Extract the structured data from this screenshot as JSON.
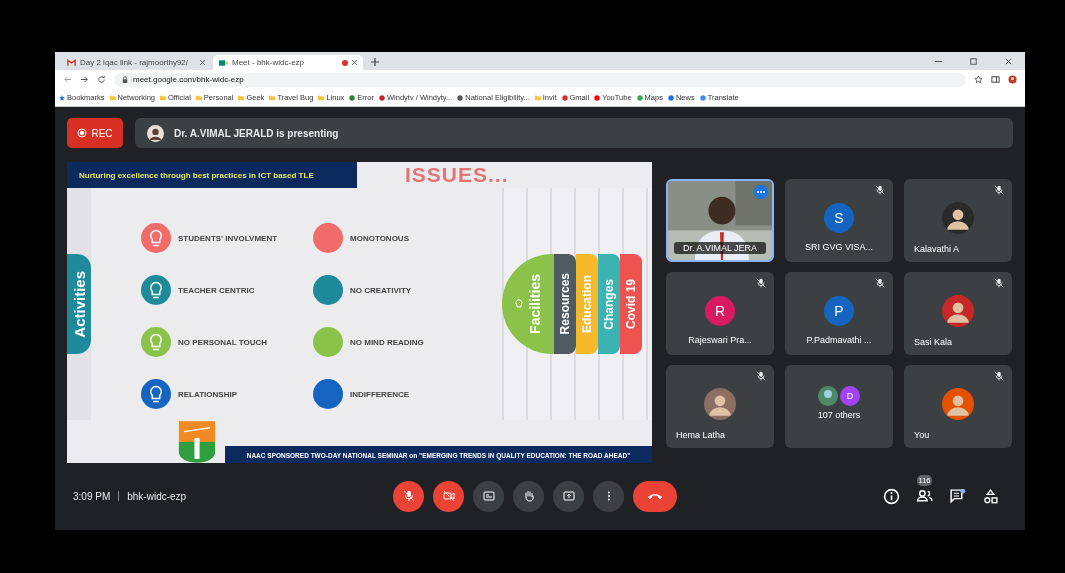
{
  "browser": {
    "tabs": [
      {
        "title": "Day 2 iqac link - rajmoorthy92/",
        "kind": "mail",
        "selected": false,
        "recording": false
      },
      {
        "title": "Meet - bhk-widc-ezp",
        "kind": "meet",
        "selected": true,
        "recording": true
      }
    ],
    "url": "meet.google.com/bhk-widc-ezp",
    "bookmarks": [
      {
        "label": "Bookmarks",
        "kind": "star",
        "color": "#1a73e8"
      },
      {
        "label": "Networking",
        "kind": "folder",
        "color": "#f9c33c"
      },
      {
        "label": "Official",
        "kind": "folder",
        "color": "#f9c33c"
      },
      {
        "label": "Personal",
        "kind": "folder",
        "color": "#f9c33c"
      },
      {
        "label": "Geek",
        "kind": "folder",
        "color": "#f9c33c"
      },
      {
        "label": "Travel Bug",
        "kind": "folder",
        "color": "#f9c33c"
      },
      {
        "label": "Linux",
        "kind": "folder",
        "color": "#f9c33c"
      },
      {
        "label": "Error",
        "kind": "site",
        "color": "#2e7d32"
      },
      {
        "label": "Windytv / Windyty...",
        "kind": "site",
        "color": "#c62828"
      },
      {
        "label": "National Eligibility...",
        "kind": "site",
        "color": "#555555"
      },
      {
        "label": "Invit",
        "kind": "folder",
        "color": "#f9c33c"
      },
      {
        "label": "Gmail",
        "kind": "site",
        "color": "#d93025"
      },
      {
        "label": "YouTube",
        "kind": "site",
        "color": "#ff0000"
      },
      {
        "label": "Maps",
        "kind": "site",
        "color": "#34a853"
      },
      {
        "label": "News",
        "kind": "site",
        "color": "#1a73e8"
      },
      {
        "label": "Translate",
        "kind": "site",
        "color": "#4285f4"
      }
    ]
  },
  "meet": {
    "rec_label": "REC",
    "presenter_text": "Dr. A.VIMAL JERALD is presenting",
    "slide": {
      "header": "Nurturing excellence through best practices in ICT based TLE",
      "title": "ISSUES...",
      "side_tab": "Activities",
      "issues": [
        {
          "label": "STUDENTS' INVOLVMENT",
          "kind": "icon",
          "color": "#f26b6b"
        },
        {
          "label": "MONOTONOUS",
          "kind": "plain",
          "color": "#f26b6b"
        },
        {
          "label": "TEACHER CENTRIC",
          "kind": "icon",
          "color": "#1f8a9a"
        },
        {
          "label": "NO CREATIVITY",
          "kind": "plain",
          "color": "#1f8a9a"
        },
        {
          "label": "NO PERSONAL TOUCH",
          "kind": "icon",
          "color": "#8bc34a"
        },
        {
          "label": "NO MIND READING",
          "kind": "plain",
          "color": "#8bc34a"
        },
        {
          "label": "RELATIONSHIP",
          "kind": "icon",
          "color": "#1565c0"
        },
        {
          "label": "INDIFFERENCE",
          "kind": "plain",
          "color": "#1565c0"
        }
      ],
      "right_tabs": [
        {
          "label": "Facilities",
          "kind": "round",
          "color": "#8bc34a"
        },
        {
          "label": "Resources",
          "kind": "strip",
          "color": "#4f5b62"
        },
        {
          "label": "Education",
          "kind": "strip",
          "color": "#f6b92b"
        },
        {
          "label": "Changes",
          "kind": "strip",
          "color": "#3bb3b3"
        },
        {
          "label": "Covid 19",
          "kind": "strip",
          "color": "#ef5350"
        }
      ],
      "footer": "NAAC SPONSORED TWO-DAY NATIONAL SEMINAR on \"EMERGING TRENDS IN QUALITY EDUCATION: THE ROAD AHEAD\""
    },
    "participants": [
      {
        "name": "Dr. A.VIMAL JERA",
        "kind": "video",
        "muted": false,
        "selected": true
      },
      {
        "name": "SRI GVG VISA...",
        "kind": "initial",
        "initial": "S",
        "color": "#1565c0",
        "muted": true,
        "selected": false
      },
      {
        "name": "Kalavathi A",
        "color": "#2a2a2a",
        "muted": true,
        "selected": false
      },
      {
        "name": "Rajeswari Pra...",
        "kind": "initial",
        "initial": "R",
        "color": "#d81b60",
        "muted": true,
        "selected": false
      },
      {
        "name": "P.Padmavathi ...",
        "kind": "initial",
        "initial": "P",
        "color": "#1565c0",
        "muted": true,
        "selected": false
      },
      {
        "name": "Sasi Kala",
        "color": "#c62828",
        "muted": true,
        "selected": false
      },
      {
        "name": "Hema Latha",
        "color": "#8d6e63",
        "muted": true,
        "selected": false
      },
      {
        "name": "107 others",
        "kind": "others",
        "initial": "D",
        "color": "#a142f4",
        "muted": false,
        "selected": false
      },
      {
        "name": "You",
        "color": "#e65100",
        "muted": true,
        "selected": false
      }
    ],
    "time": "3:09 PM",
    "meeting_code": "bhk-widc-ezp",
    "mic_on": false,
    "camera_on": false,
    "people_count": "116",
    "chat_unread": true
  }
}
